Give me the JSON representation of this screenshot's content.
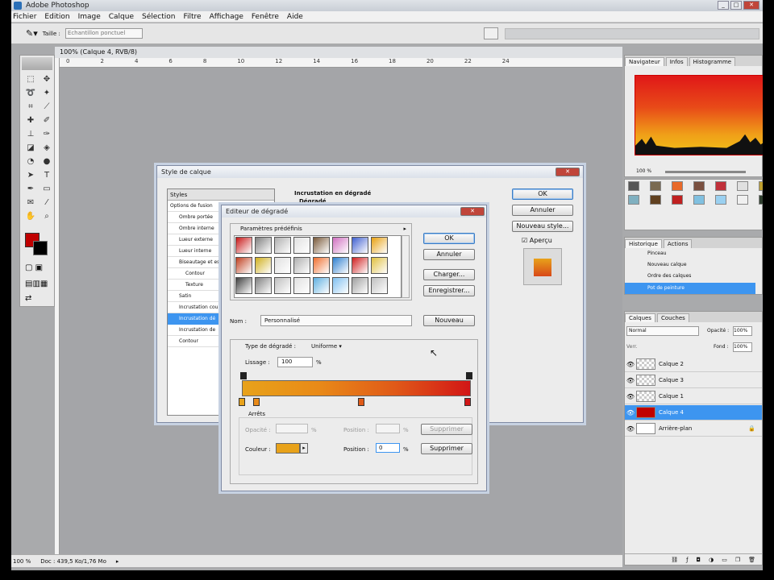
{
  "app": {
    "title": "Adobe Photoshop"
  },
  "menu": [
    "Fichier",
    "Edition",
    "Image",
    "Calque",
    "Sélection",
    "Filtre",
    "Affichage",
    "Fenêtre",
    "Aide"
  ],
  "options": {
    "taille_label": "Taille :",
    "taille_value": "Echantillon ponctuel"
  },
  "document": {
    "title": "100% (Calque 4, RVB/8)",
    "ruler_ticks": [
      "0",
      "2",
      "4",
      "6",
      "8",
      "10",
      "12",
      "14",
      "16",
      "18",
      "20",
      "22",
      "24"
    ],
    "zoom": "100 %",
    "doc_info": "Doc : 439,5 Ko/1,76 Mo"
  },
  "style_dialog": {
    "title": "Style de calque",
    "list": [
      "Styles",
      "Options de fusion",
      "Ombre portée",
      "Ombre interne",
      "Lueur externe",
      "Lueur interne",
      "Biseautage et es",
      "Contour",
      "Texture",
      "Satin",
      "Incrustation cou",
      "Incrustation dé",
      "Incrustation de",
      "Contour"
    ],
    "section_title": "Incrustation en dégradé",
    "section_sub": "Dégradé",
    "buttons": {
      "ok": "OK",
      "cancel": "Annuler",
      "new_style": "Nouveau style...",
      "preview": "Aperçu"
    },
    "preview_color": "#e76a18"
  },
  "gradient_editor": {
    "title": "Editeur de dégradé",
    "presets_label": "Paramètres prédéfinis",
    "buttons": {
      "ok": "OK",
      "cancel": "Annuler",
      "load": "Charger...",
      "save": "Enregistrer...",
      "new": "Nouveau",
      "delete1": "Supprimer",
      "delete2": "Supprimer"
    },
    "name_label": "Nom :",
    "name_value": "Personnalisé",
    "type_label": "Type de dégradé :",
    "type_value": "Uniforme",
    "smooth_label": "Lissage :",
    "smooth_value": "100",
    "percent": "%",
    "stops_label": "Arrêts",
    "opacity_label": "Opacité :",
    "position_label": "Position :",
    "color_label": "Couleur :",
    "position_value": "0",
    "gradient_colors": [
      "#e8a21a",
      "#e98a18",
      "#e05a18",
      "#d21616"
    ],
    "color_swatch": "#e8a21a",
    "preset_colors": [
      "#c81818",
      "#808080",
      "#b0b0b0",
      "#e0e0e0",
      "#7a5a3a",
      "#d070c0",
      "#4060d0",
      "#e8a010",
      "#c04020",
      "#d0b020",
      "#e0e0e0",
      "#b0b0b0",
      "#f07030",
      "#3080d0",
      "#d02020",
      "#e0c040",
      "#404040",
      "#808080",
      "#c0c0c0",
      "#e0e0e0",
      "#60b0e0",
      "#80c0f0",
      "#a0a0a0",
      "#c0c0c0"
    ]
  },
  "navigator": {
    "tabs": [
      "Navigateur",
      "Infos",
      "Histogramme"
    ],
    "zoom": "100 %"
  },
  "swatches": {
    "colors": [
      "#555555",
      "#7a6a50",
      "#e86a2a",
      "#7a5040",
      "#c0303a",
      "#e0e0e0",
      "#c0a030",
      "#80b0c0",
      "#604020",
      "#c02020",
      "#80c0e0",
      "#9ad0f0",
      "#f0f0f0",
      "#304030"
    ]
  },
  "history": {
    "tabs": [
      "Historique",
      "Actions"
    ],
    "items": [
      "Pinceau",
      "Nouveau calque",
      "Ordre des calques",
      "Pot de peinture"
    ]
  },
  "layers": {
    "tabs": [
      "Calques",
      "Couches"
    ],
    "mode": "Normal",
    "opacity_label": "Opacité :",
    "opacity_value": "100%",
    "fill_label": "Fond :",
    "fill_value": "100%",
    "lock_label": "Verr.",
    "rows": [
      "Calque 2",
      "Calque 3",
      "Calque 1",
      "Calque 4",
      "Arrière-plan"
    ]
  }
}
